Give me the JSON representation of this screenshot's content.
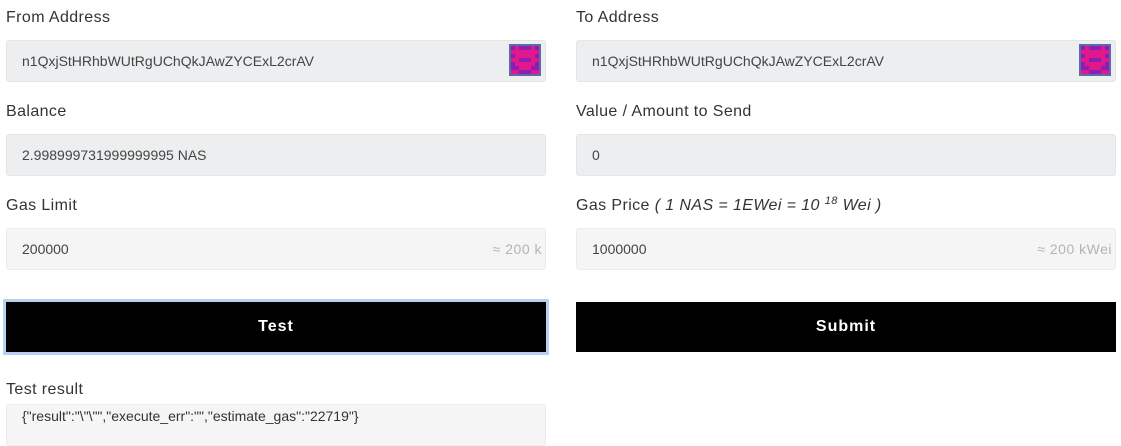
{
  "from": {
    "label": "From Address",
    "value": "n1QxjStHRhbWUtRgUChQkJAwZYCExL2crAV",
    "identicon": "identicon-avatar"
  },
  "to": {
    "label": "To Address",
    "value": "n1QxjStHRhbWUtRgUChQkJAwZYCExL2crAV",
    "identicon": "identicon-avatar"
  },
  "balance": {
    "label": "Balance",
    "value": "2.998999731999999995 NAS"
  },
  "amount": {
    "label": "Value / Amount to Send",
    "value": "0"
  },
  "gas_limit": {
    "label": "Gas Limit",
    "value": "200000",
    "hint": "≈ 200 k"
  },
  "gas_price": {
    "label": "Gas Price",
    "note_prefix": "( 1 NAS = 1EWei = 10",
    "note_exp": "18",
    "note_suffix": "Wei )",
    "value": "1000000",
    "hint": "≈ 200 kWei"
  },
  "buttons": {
    "test": "Test",
    "submit": "Submit"
  },
  "test_result": {
    "label": "Test result",
    "value": "{\"result\":\"\\\"\\\"\",\"execute_err\":\"\",\"estimate_gas\":\"22719\"}"
  },
  "colors": {
    "identicon_fill": "#e0188c",
    "identicon_bg": "#8b1fb3",
    "button_bg": "#000000",
    "focus_ring": "#b8d1f2"
  }
}
